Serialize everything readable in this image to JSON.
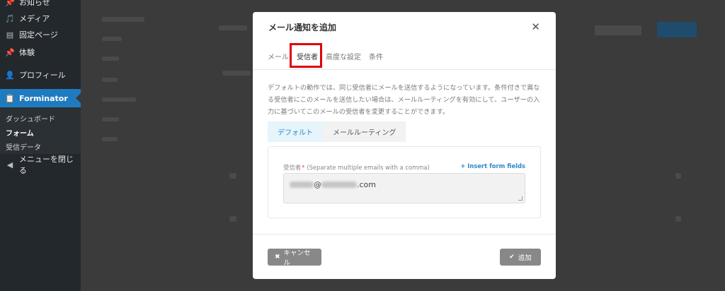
{
  "sidebar": {
    "items": [
      {
        "icon": "pin-icon",
        "glyph": "📌",
        "label": "お知らせ"
      },
      {
        "icon": "media-icon",
        "glyph": "🎵",
        "label": "メディア"
      },
      {
        "icon": "page-icon",
        "glyph": "▤",
        "label": "固定ページ"
      },
      {
        "icon": "pin-icon",
        "glyph": "📌",
        "label": "体験"
      },
      {
        "icon": "user-icon",
        "glyph": "👤",
        "label": "プロフィール"
      },
      {
        "icon": "clipboard-icon",
        "glyph": "📋",
        "label": "Forminator"
      }
    ],
    "submenu": [
      "ダッシュボード",
      "フォーム",
      "受信データ"
    ],
    "collapse": {
      "glyph": "◀",
      "label": "メニューを閉じる"
    }
  },
  "modal": {
    "title": "メール通知を追加",
    "close_glyph": "✕",
    "tabs": [
      "メール",
      "受信者",
      "高度な設定",
      "条件"
    ],
    "active_tab": "受信者",
    "description": "デフォルトの動作では、同じ受信者にメールを送信するようになっています。条件付きで異なる受信者にこのメールを送信したい場合は、メールルーティングを有効にして、ユーザーの入力に基づいてこのメールの受信者を変更することができます。",
    "routing_tabs": [
      "デフォルト",
      "メールルーティング"
    ],
    "field": {
      "label": "受信者",
      "required_mark": "*",
      "hint": "(Separate multiple emails with a comma)",
      "insert_link": "+ Insert form fields",
      "email_at": "@",
      "email_tld": ".com"
    },
    "footer": {
      "cancel_glyph": "✖",
      "cancel_label": "キャンセル",
      "add_glyph": "✔",
      "add_label": "追加"
    }
  },
  "colors": {
    "highlight": "#e0000b",
    "wp_blue": "#1e7bbf",
    "link_blue": "#2c89c6"
  }
}
